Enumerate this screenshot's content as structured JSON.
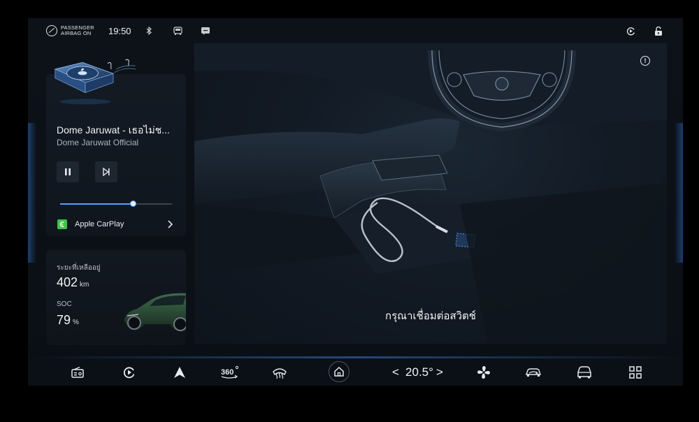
{
  "status_bar": {
    "airbag_line1": "PASSENGER",
    "airbag_line2": "AIRBAG ON",
    "time": "19:50"
  },
  "media": {
    "title": "Dome Jaruwat - เธอไม่ช...",
    "artist": "Dome Jaruwat Official",
    "progress": 0.65,
    "source_label": "Apple CarPlay"
  },
  "vehicle": {
    "range_label": "ระยะที่เหลืออยู่",
    "range_value": "402",
    "range_unit": "km",
    "soc_label": "SOC",
    "soc_value": "79",
    "soc_unit": "%"
  },
  "main": {
    "instruction": "กรุณาเชื่อมต่อสวิตช์"
  },
  "climate": {
    "temperature": "20.5°",
    "decrease": "<",
    "increase": ">"
  },
  "colors": {
    "accent": "#4aa3ff",
    "carplay": "#3ec34a"
  },
  "icons": [
    "airbag-icon",
    "bluetooth-icon",
    "car-status-icon",
    "message-icon",
    "playback-icon",
    "lock-icon",
    "info-icon",
    "radio-icon",
    "media-play-icon",
    "navigation-icon",
    "camera-360-icon",
    "defrost-icon",
    "home-icon",
    "fan-icon",
    "recirculation-icon",
    "car-settings-icon",
    "apps-grid-icon"
  ]
}
